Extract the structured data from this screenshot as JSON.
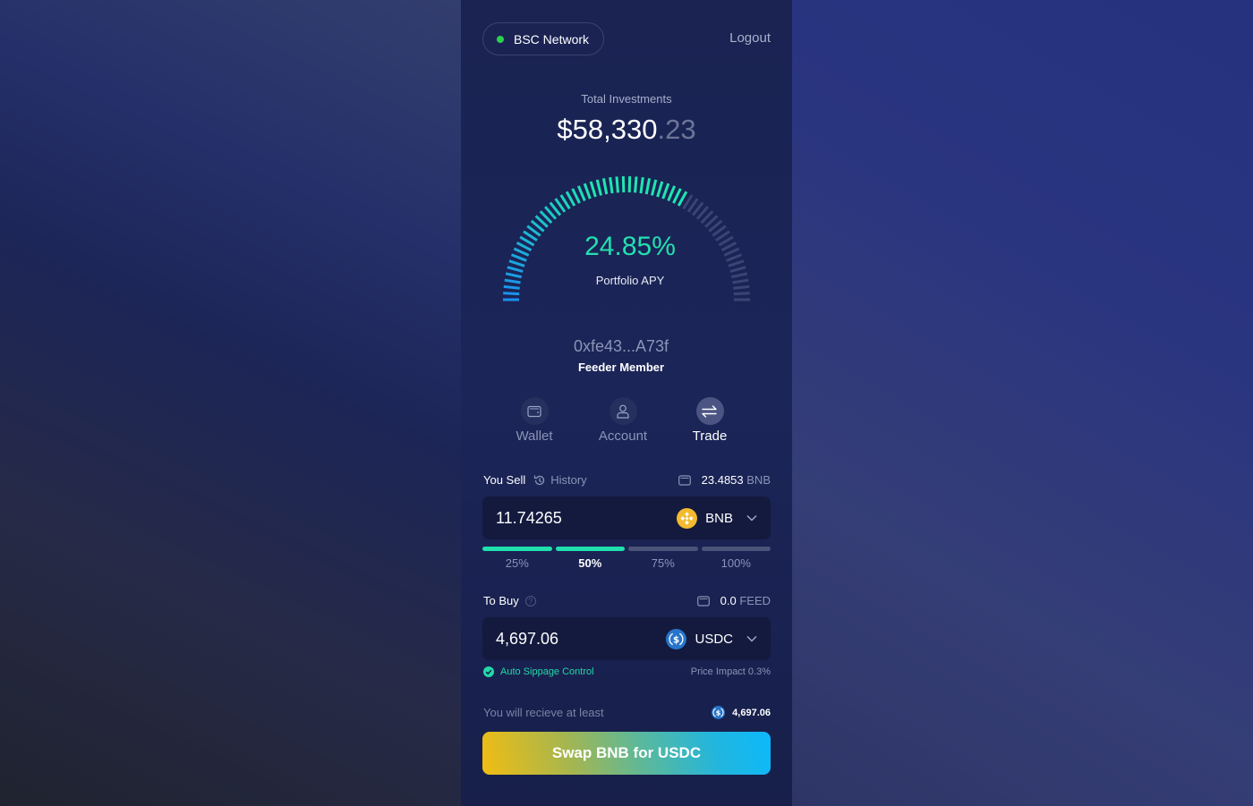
{
  "header": {
    "network_label": "BSC Network",
    "network_status_color": "#2bd14d",
    "logout_label": "Logout"
  },
  "summary": {
    "total_label": "Total Investments",
    "total_whole": "$58,330",
    "total_cents": ".23"
  },
  "gauge": {
    "apy_value": "24.85%",
    "apy_label": "Portfolio APY",
    "fill_fraction": 0.67,
    "active_color_start": "#1a8ff0",
    "active_color_end": "#1fe6b0",
    "inactive_color": "#3a4575"
  },
  "account": {
    "address": "0xfe43...A73f",
    "tier": "Feeder Member"
  },
  "nav": {
    "items": [
      {
        "label": "Wallet",
        "icon": "wallet-icon",
        "active": false
      },
      {
        "label": "Account",
        "icon": "user-icon",
        "active": false
      },
      {
        "label": "Trade",
        "icon": "swap-arrows-icon",
        "active": true
      }
    ]
  },
  "sell": {
    "title": "You Sell",
    "history_label": "History",
    "balance_value": "23.4853",
    "balance_unit": "BNB",
    "amount": "11.74265",
    "token": "BNB",
    "token_color": "#f3ba2f",
    "percent_options": [
      {
        "label": "25%",
        "filled": true,
        "selected": false
      },
      {
        "label": "50%",
        "filled": true,
        "selected": true
      },
      {
        "label": "75%",
        "filled": false,
        "selected": false
      },
      {
        "label": "100%",
        "filled": false,
        "selected": false
      }
    ]
  },
  "buy": {
    "title": "To Buy",
    "balance_value": "0.0",
    "balance_unit": "FEED",
    "amount": "4,697.06",
    "token": "USDC",
    "token_color": "#2775ca",
    "auto_slippage_label": "Auto Sippage Control",
    "price_impact_label": "Price Impact 0.3%"
  },
  "receive": {
    "label": "You will recieve at least",
    "amount": "4,697.06"
  },
  "swap_button": {
    "label": "Swap BNB for USDC"
  }
}
